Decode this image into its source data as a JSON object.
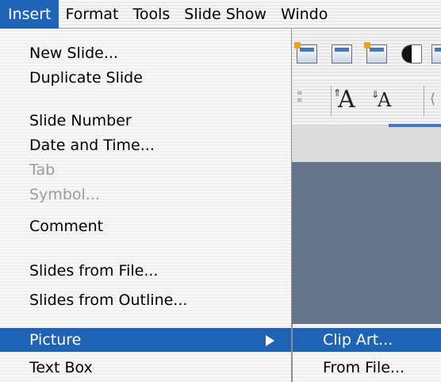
{
  "menubar": {
    "items": [
      "Insert",
      "Format",
      "Tools",
      "Slide Show",
      "Windo"
    ],
    "active": "Insert"
  },
  "insert_menu": {
    "groups": [
      [
        "New Slide...",
        "Duplicate Slide"
      ],
      [
        "Slide Number",
        "Date and Time...",
        "Tab",
        "Symbol...",
        "Comment"
      ],
      [
        "Slides from File...",
        "Slides from Outline..."
      ],
      [
        "Picture",
        "Text Box"
      ]
    ],
    "items": {
      "new_slide": "New Slide...",
      "duplicate_slide": "Duplicate Slide",
      "slide_number": "Slide Number",
      "date_and_time": "Date and Time...",
      "tab": "Tab",
      "symbol": "Symbol...",
      "comment": "Comment",
      "slides_from_file": "Slides from File...",
      "slides_from_outline": "Slides from Outline...",
      "picture": "Picture",
      "text_box": "Text Box"
    },
    "disabled": [
      "Tab",
      "Symbol..."
    ],
    "highlighted": "Picture"
  },
  "picture_submenu": {
    "clip_art": "Clip Art...",
    "from_file": "From File...",
    "highlighted": "Clip Art..."
  },
  "colors": {
    "selection_blue": "#1f63b6",
    "slide_background": "#65758a",
    "disabled_text": "#9c9c9c"
  }
}
